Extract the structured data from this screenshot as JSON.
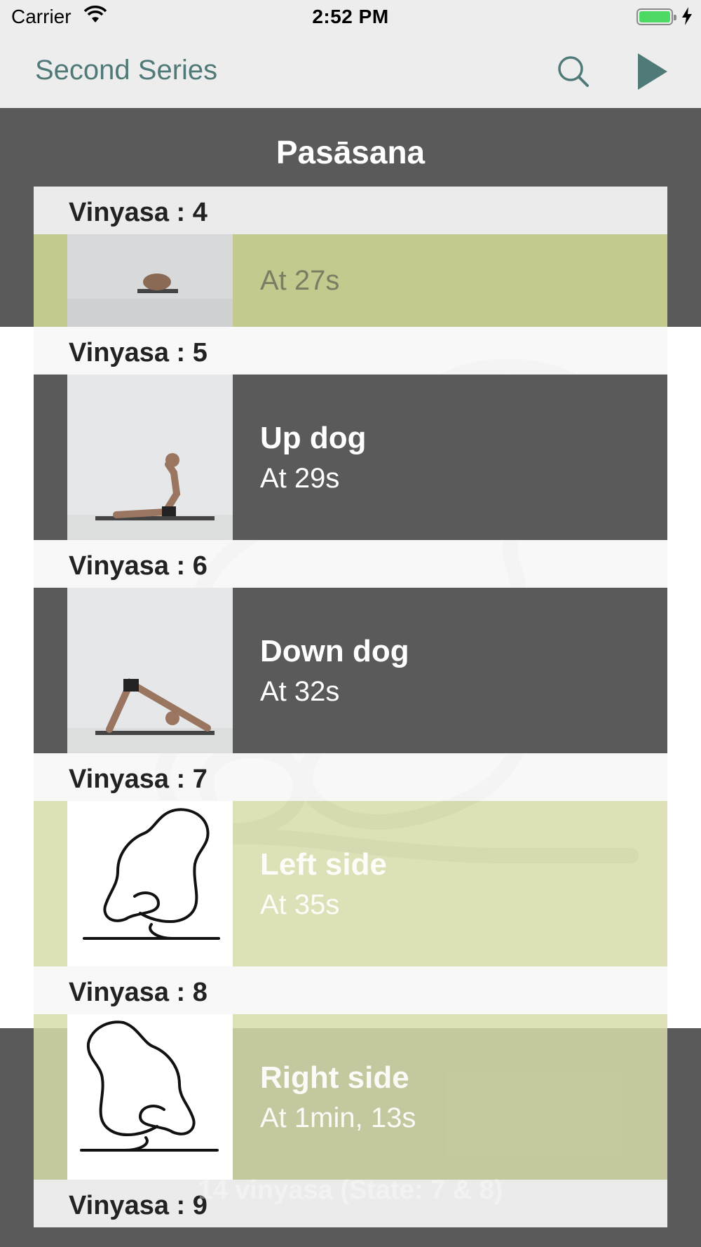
{
  "status_bar": {
    "carrier": "Carrier",
    "time": "2:52 PM",
    "battery_color": "#4cd964"
  },
  "nav": {
    "title": "Second Series",
    "search_icon": "search-icon",
    "play_icon": "play-icon",
    "accent": "#4f7a78"
  },
  "pose": {
    "title": "Pasāsana"
  },
  "sections": [
    {
      "header": "Vinyasa : 4",
      "name": "",
      "time": "At 27s",
      "style": "green",
      "thumb": "photo-prone"
    },
    {
      "header": "Vinyasa : 5",
      "name": "Up dog",
      "time": "At 29s",
      "style": "dark",
      "thumb": "photo-updog"
    },
    {
      "header": "Vinyasa : 6",
      "name": "Down dog",
      "time": "At 32s",
      "style": "dark",
      "thumb": "photo-downdog"
    },
    {
      "header": "Vinyasa : 7",
      "name": "Left side",
      "time": "At 35s",
      "style": "pale",
      "thumb": "drawing-pasasana-left"
    },
    {
      "header": "Vinyasa : 8",
      "name": "Right side",
      "time": "At 1min, 13s",
      "style": "pale",
      "thumb": "drawing-pasasana-right"
    },
    {
      "header": "Vinyasa : 9"
    }
  ],
  "footer": {
    "text": "14 vinyasa (State: 7 & 8)"
  }
}
